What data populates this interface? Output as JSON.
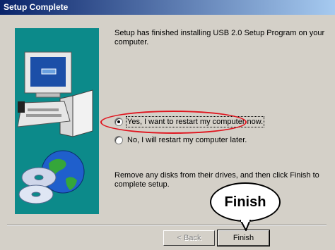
{
  "window": {
    "title": "Setup Complete"
  },
  "message_top": "Setup has finished installing USB 2.0 Setup Program on your computer.",
  "options": [
    {
      "label": "Yes, I want to restart my computer now.",
      "selected": true
    },
    {
      "label": "No, I will restart my computer later.",
      "selected": false
    }
  ],
  "message_bottom": "Remove any disks from their drives, and then click Finish to complete setup.",
  "buttons": {
    "back": "< Back",
    "finish": "Finish"
  },
  "callout": "Finish",
  "colors": {
    "title_start": "#0a246a",
    "title_end": "#a6caf0",
    "highlight": "#e0141e",
    "dialog_bg": "#d4d0c8"
  },
  "illustration": {
    "icons": [
      "computer-icon",
      "globe-icon",
      "cd-disc-icon"
    ]
  }
}
